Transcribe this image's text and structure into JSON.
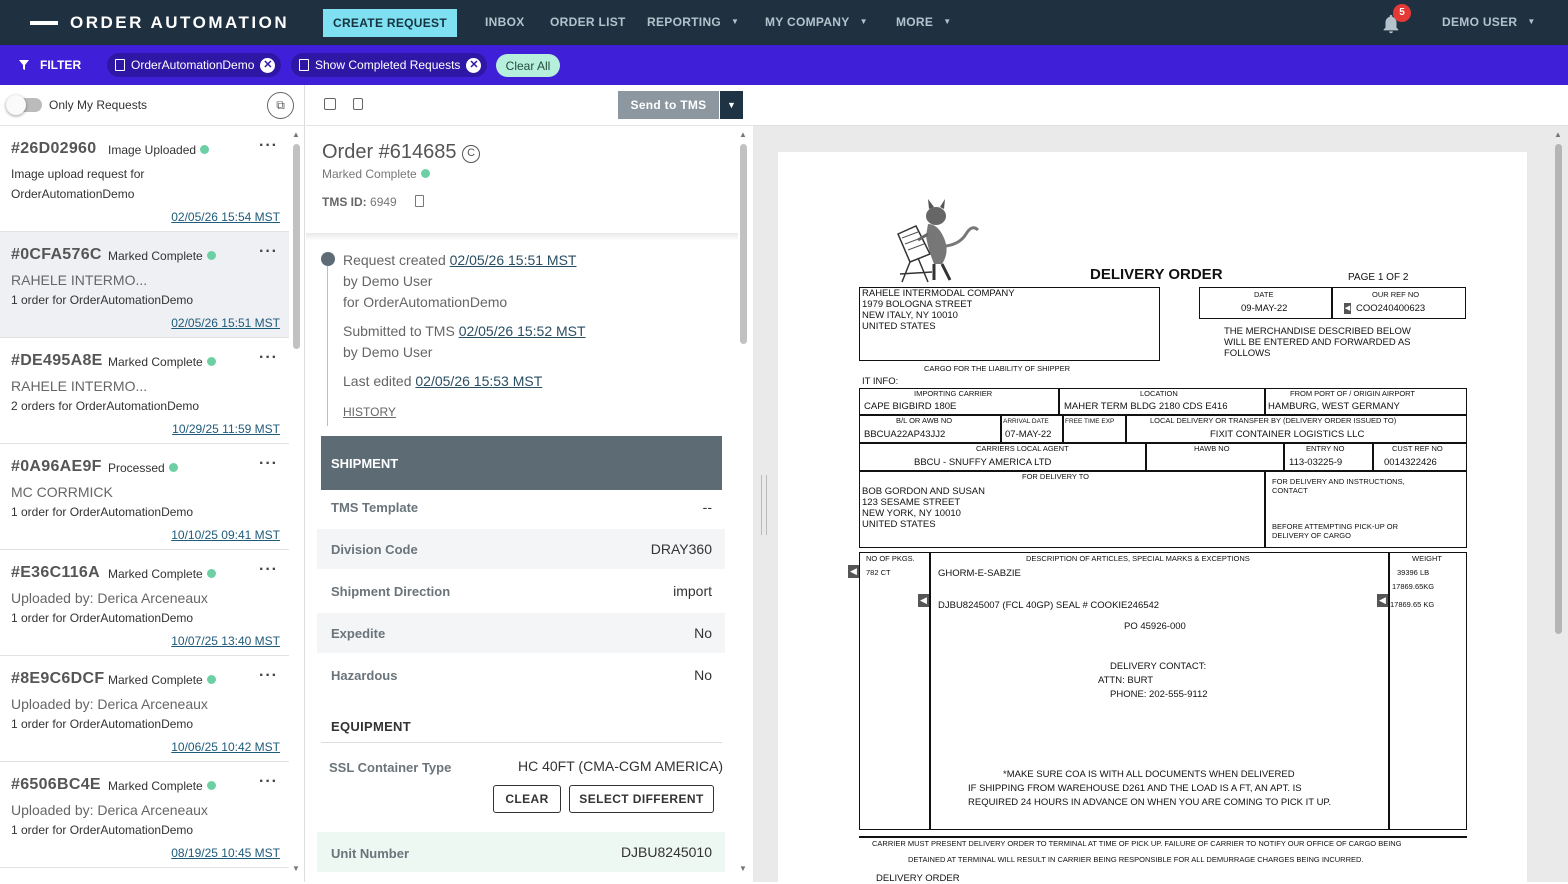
{
  "app": {
    "title": "ORDER AUTOMATION"
  },
  "topnav": {
    "create_label": "CREATE REQUEST",
    "items": [
      "INBOX",
      "ORDER LIST",
      "REPORTING",
      "MY COMPANY",
      "MORE"
    ],
    "notifications": "5",
    "user": "DEMO USER"
  },
  "filterbar": {
    "label": "FILTER",
    "chips": [
      "OrderAutomationDemo",
      "Show Completed Requests"
    ],
    "clear_all": "Clear All"
  },
  "sidebar": {
    "only_my_label": "Only My Requests",
    "requests": [
      {
        "id": "#26D02960",
        "status": "Image Uploaded",
        "line2": "Image upload request for",
        "line3": "OrderAutomationDemo",
        "date": "02/05/26 15:54 MST",
        "small": true
      },
      {
        "id": "#0CFA576C",
        "status": "Marked Complete",
        "line2": "RAHELE INTERMO...",
        "line3": "1 order for OrderAutomationDemo",
        "date": "02/05/26 15:51 MST",
        "selected": true
      },
      {
        "id": "#DE495A8E",
        "status": "Marked Complete",
        "line2": "RAHELE INTERMO...",
        "line3": "2 orders for OrderAutomationDemo",
        "date": "10/29/25 11:59 MST"
      },
      {
        "id": "#0A96AE9F",
        "status": "Processed",
        "line2": "MC CORRMICK",
        "line3": "1 order for OrderAutomationDemo",
        "date": "10/10/25 09:41 MST"
      },
      {
        "id": "#E36C116A",
        "status": "Marked Complete",
        "line2": "Uploaded by: Derica Arceneaux",
        "line3": "1 order for OrderAutomationDemo",
        "date": "10/07/25 13:40 MST"
      },
      {
        "id": "#8E9C6DCF",
        "status": "Marked Complete",
        "line2": "Uploaded by: Derica Arceneaux",
        "line3": "1 order for OrderAutomationDemo",
        "date": "10/06/25 10:42 MST"
      },
      {
        "id": "#6506BC4E",
        "status": "Marked Complete",
        "line2": "Uploaded by: Derica Arceneaux",
        "line3": "1 order for OrderAutomationDemo",
        "date": "08/19/25 10:45 MST"
      }
    ]
  },
  "order": {
    "send_label": "Send to TMS",
    "title": "Order #614685",
    "status": "Marked Complete",
    "tms_label": "TMS ID:",
    "tms_id": "6949",
    "timeline": {
      "created_prefix": "Request created",
      "created_date": "02/05/26 15:51 MST",
      "created_by": "by Demo User",
      "created_for": "for OrderAutomationDemo",
      "submitted_prefix": "Submitted to TMS",
      "submitted_date": "02/05/26 15:52 MST",
      "submitted_by": "by Demo User",
      "edited_prefix": "Last edited",
      "edited_date": "02/05/26 15:53 MST",
      "history": "HISTORY"
    },
    "shipment_header": "SHIPMENT",
    "fields": [
      {
        "label": "TMS Template",
        "value": "--"
      },
      {
        "label": "Division Code",
        "value": "DRAY360"
      },
      {
        "label": "Shipment Direction",
        "value": "import"
      },
      {
        "label": "Expedite",
        "value": "No"
      },
      {
        "label": "Hazardous",
        "value": "No"
      }
    ],
    "equipment_header": "EQUIPMENT",
    "ssl_label": "SSL Container Type",
    "ssl_value": "HC 40FT (CMA-CGM AMERICA)",
    "clear_btn": "CLEAR",
    "select_btn": "SELECT DIFFERENT",
    "unit_label": "Unit Number",
    "unit_value": "DJBU8245010"
  },
  "document": {
    "title": "DELIVERY ORDER",
    "page": "PAGE 1 OF 2",
    "consignee": [
      "RAHELE INTERMODAL COMPANY",
      "1979 BOLOGNA STREET",
      "NEW ITALY, NY 10010",
      "UNITED STATES"
    ],
    "date_label": "DATE",
    "date_value": "09-MAY-22",
    "ref_label": "OUR REF NO",
    "ref_value": "COO240400623",
    "merch_note": [
      "THE MERCHANDISE DESCRIBED BELOW",
      "WILL BE ENTERED AND FORWARDED AS",
      "FOLLOWS"
    ],
    "cargo_note": "CARGO FOR THE LIABILITY OF SHIPPER",
    "it_info": "IT INFO:",
    "importing_carrier_label": "IMPORTING CARRIER",
    "importing_carrier": "CAPE BIGBIRD 180E",
    "location_label": "LOCATION",
    "location": "MAHER TERM BLDG 2180 CDS E416",
    "port_label": "FROM PORT OF / ORIGIN AIRPORT",
    "port": "HAMBURG, WEST GERMANY",
    "bl_label": "B/L OR AWB NO",
    "bl": "BBCUA22AP43JJ2",
    "arrival_label": "ARRIVAL DATE",
    "arrival": "07-MAY-22",
    "free_label": "FREE TIME EXP",
    "local_label": "LOCAL DELIVERY OR TRANSFER BY (DELIVERY ORDER ISSUED TO)",
    "local": "FIXIT CONTAINER LOGISTICS LLC",
    "agent_label": "CARRIERS LOCAL AGENT",
    "agent": "BBCU - SNUFFY AMERICA LTD",
    "hawb_label": "HAWB NO",
    "entry_label": "ENTRY NO",
    "entry": "113-03225-9",
    "cust_label": "CUST REF NO",
    "cust": "0014322426",
    "for_delivery_label": "FOR DELIVERY TO",
    "delivery_to": [
      "BOB GORDON AND SUSAN",
      "123 SESAME STREET",
      "NEW YORK, NY 10010",
      "UNITED STATES"
    ],
    "instructions": [
      "FOR DELIVERY AND INSTRUCTIONS,",
      "CONTACT"
    ],
    "before_pickup": [
      "BEFORE ATTEMPTING PICK-UP OR",
      "DELIVERY OF CARGO"
    ],
    "pkgs_label": "NO OF PKGS.",
    "pkgs": "782 CT",
    "desc_label": "DESCRIPTION OF ARTICLES, SPECIAL MARKS & EXCEPTIONS",
    "weight_label": "WEIGHT",
    "desc_1": "GHORM-E-SABZIE",
    "desc_2": "DJBU8245007 (FCL 40GP) SEAL # COOKIE246542",
    "desc_3": "PO 45926-000",
    "weight_1": "39396 LB",
    "weight_2": "17869.65KG",
    "weight_3": "17869.65 KG",
    "contact": [
      "DELIVERY CONTACT:",
      "ATTN: BURT",
      "PHONE: 202-555-9112"
    ],
    "notes": [
      "*MAKE SURE COA IS WITH ALL DOCUMENTS WHEN DELIVERED",
      "IF SHIPPING FROM WAREHOUSE D261 AND THE LOAD IS A FT, AN APT. IS",
      "REQUIRED 24 HOURS IN ADVANCE ON WHEN YOU ARE COMING TO PICK IT UP."
    ],
    "footer": [
      "CARRIER MUST PRESENT DELIVERY ORDER TO TERMINAL AT TIME OF PICK UP. FAILURE OF CARRIER TO NOTIFY OUR OFFICE OF CARGO BEING",
      "DETAINED AT TERMINAL WILL RESULT IN CARRIER BEING RESPONSIBLE FOR ALL DEMURRAGE CHARGES BEING INCURRED."
    ],
    "footer_title": "DELIVERY ORDER"
  },
  "colors": {
    "topbar": "#1f3140",
    "filterbar": "#3f1fd8",
    "create": "#7ee0f0",
    "status_dot": "#6dd0a4",
    "badge": "#e53935"
  }
}
